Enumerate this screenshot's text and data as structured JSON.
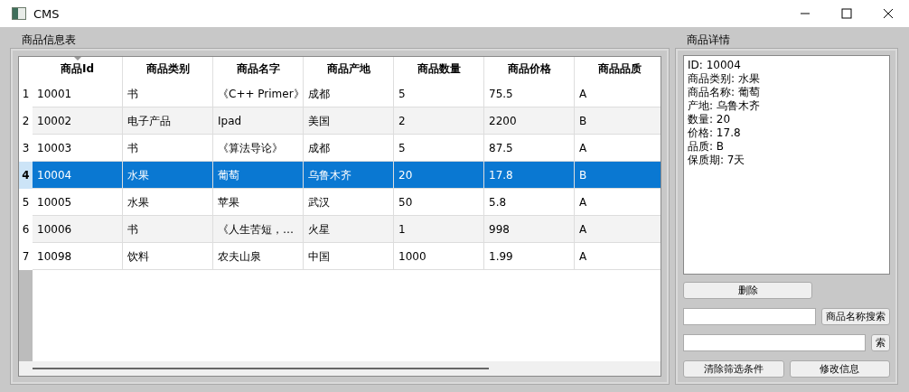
{
  "window": {
    "title": "CMS"
  },
  "table_group": {
    "title": "商品信息表"
  },
  "table": {
    "columns": [
      "商品Id",
      "商品类别",
      "商品名字",
      "商品产地",
      "商品数量",
      "商品价格",
      "商品品质"
    ],
    "rows": [
      {
        "number": "1",
        "selected": false,
        "cells": [
          "10001",
          "书",
          "《C++ Primer》",
          "成都",
          "5",
          "75.5",
          "A"
        ]
      },
      {
        "number": "2",
        "selected": false,
        "cells": [
          "10002",
          "电子产品",
          "Ipad",
          "美国",
          "2",
          "2200",
          "B"
        ]
      },
      {
        "number": "3",
        "selected": false,
        "cells": [
          "10003",
          "书",
          "《算法导论》",
          "成都",
          "5",
          "87.5",
          "A"
        ]
      },
      {
        "number": "4",
        "selected": true,
        "cells": [
          "10004",
          "水果",
          "葡萄",
          "乌鲁木齐",
          "20",
          "17.8",
          "B"
        ]
      },
      {
        "number": "5",
        "selected": false,
        "cells": [
          "10005",
          "水果",
          "苹果",
          "武汉",
          "50",
          "5.8",
          "A"
        ]
      },
      {
        "number": "6",
        "selected": false,
        "cells": [
          "10006",
          "书",
          "《人生苦短，…",
          "火星",
          "1",
          "998",
          "A"
        ]
      },
      {
        "number": "7",
        "selected": false,
        "cells": [
          "10098",
          "饮料",
          "农夫山泉",
          "中国",
          "1000",
          "1.99",
          "A"
        ]
      }
    ]
  },
  "detail_group": {
    "title": "商品详情",
    "lines": [
      "ID: 10004",
      "商品类别: 水果",
      "商品名称: 葡萄",
      "产地: 乌鲁木齐",
      "数量: 20",
      "价格: 17.8",
      "品质: B",
      "保质期: 7天"
    ]
  },
  "controls": [
    {
      "kind": "button",
      "label": "删除"
    },
    {
      "kind": "search",
      "button": "商品名称搜索"
    },
    {
      "kind": "search",
      "button": "索"
    },
    {
      "kind": "pair",
      "buttons": [
        "清除筛选条件",
        "修改信息"
      ]
    }
  ]
}
